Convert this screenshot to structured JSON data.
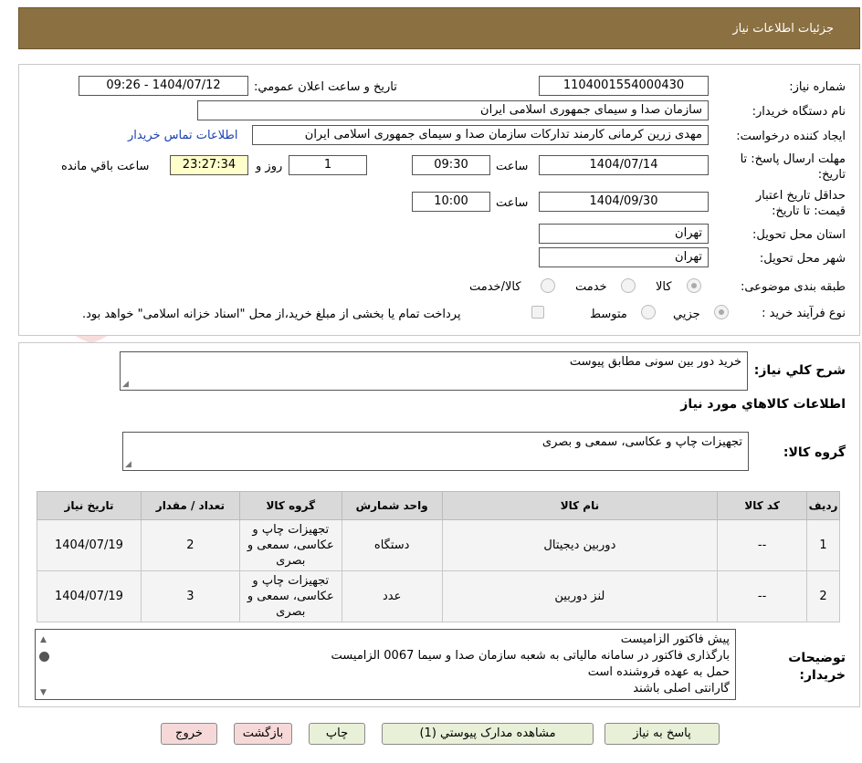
{
  "header": {
    "title": "جزئیات اطلاعات نیاز"
  },
  "form": {
    "need_number_label": "شماره نیاز:",
    "need_number": "1104001554000430",
    "announce_label": "تاریخ و ساعت اعلان عمومي:",
    "announce_value": "1404/07/12 - 09:26",
    "buyer_org_label": "نام دستگاه خريدار:",
    "buyer_org": "سازمان صدا و سیمای جمهوری اسلامی ایران",
    "requester_label": "ايجاد كننده درخواست:",
    "requester": "مهدی زرین کرمانی کارمند تدارکات سازمان صدا و سیمای جمهوری اسلامی ایران",
    "contact_link": "اطلاعات تماس خريدار",
    "deadline_label": "مهلت ارسال پاسخ: تا تاریخ:",
    "deadline_date": "1404/07/14",
    "time_word": "ساعت",
    "deadline_time": "09:30",
    "days_value": "1",
    "days_word": "روز و",
    "remaining_time": "23:27:34",
    "remaining_word": "ساعت باقي مانده",
    "validity_label": "حداقل تاريخ اعتبار قيمت: تا تاريخ:",
    "validity_date": "1404/09/30",
    "validity_time": "10:00",
    "province_label": "استان محل تحويل:",
    "province": "تهران",
    "city_label": "شهر محل تحويل:",
    "city": "تهران",
    "category_label": "طبقه بندی موضوعی:",
    "category_options": [
      "کالا",
      "خدمت",
      "کالا/خدمت"
    ],
    "process_label": "نوع فرآيند خريد :",
    "process_options": [
      "جزيي",
      "متوسط"
    ],
    "payment_note": "پرداخت تمام يا بخشی از مبلغ خريد،از محل \"اسناد خزانه اسلامی\" خواهد بود."
  },
  "summary": {
    "label": "شرح كلي نياز:",
    "value": "خرید دور بین سونی مطابق پیوست"
  },
  "goods_info": {
    "title": "اطلاعات كالاهاي مورد نياز",
    "group_label": "گروه كالا:",
    "group_value": "تجهیزات چاپ و عکاسی، سمعی و بصری"
  },
  "table": {
    "headers": [
      "رديف",
      "كد كالا",
      "نام كالا",
      "واحد شمارش",
      "گروه كالا",
      "تعداد / مقدار",
      "تاريخ نياز"
    ],
    "rows": [
      [
        "1",
        "--",
        "دوربین دیجیتال",
        "دستگاه",
        "تجهیزات چاپ و عکاسی، سمعی و بصری",
        "2",
        "1404/07/19"
      ],
      [
        "2",
        "--",
        "لنز دوربین",
        "عدد",
        "تجهیزات چاپ و عکاسی، سمعی و بصری",
        "3",
        "1404/07/19"
      ]
    ]
  },
  "notes": {
    "label": "توضيحات خريدار:",
    "lines": [
      "پیش فاکتور الزامیست",
      "بارگذاری فاکتور در سامانه مالیاتی به شعبه سازمان صدا و سیما 0067 الزامیست",
      "حمل به عهده فروشنده است",
      "گارانتی اصلی باشند"
    ]
  },
  "buttons": {
    "reply": "پاسخ به نياز",
    "attachments": "مشاهده مدارک پيوستي (1)",
    "print": "چاپ",
    "back": "بازگشت",
    "exit": "خروج"
  },
  "watermark": {
    "text": "AriaTender.neT"
  }
}
